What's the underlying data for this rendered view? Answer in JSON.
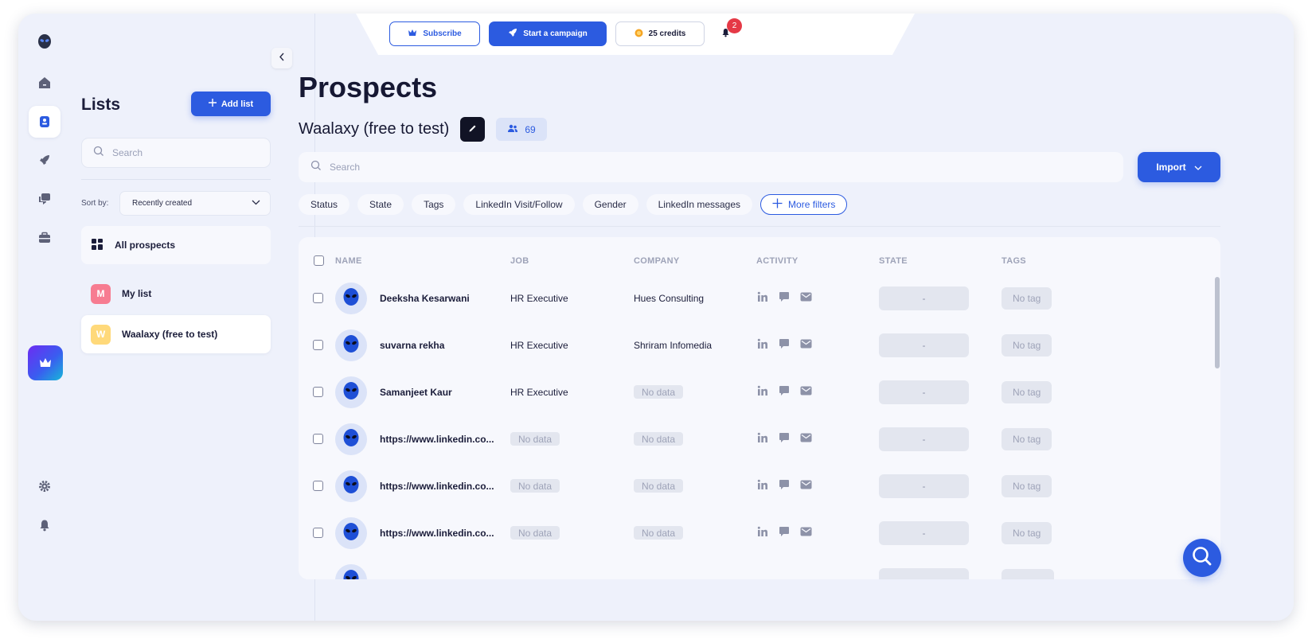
{
  "colors": {
    "brand": "#2c5be0",
    "badge_red": "#e53946",
    "list_my": "#f77c91",
    "list_waalaxy": "#ffd97a"
  },
  "rail": {
    "items": [
      {
        "name": "logo-icon"
      },
      {
        "name": "home-icon"
      },
      {
        "name": "prospects-icon"
      },
      {
        "name": "campaigns-rocket-icon"
      },
      {
        "name": "inbox-chat-icon"
      },
      {
        "name": "toolbox-icon"
      },
      {
        "name": "premium-crown-icon"
      },
      {
        "name": "settings-gear-icon"
      },
      {
        "name": "notifications-bell-icon"
      }
    ]
  },
  "topbar": {
    "subscribe_label": "Subscribe",
    "campaign_label": "Start a campaign",
    "credits_label": "25 credits",
    "notification_count": "2"
  },
  "lists_panel": {
    "title": "Lists",
    "add_label": "Add list",
    "search_placeholder": "Search",
    "sort_label": "Sort by:",
    "sort_value": "Recently created",
    "all_label": "All prospects",
    "items": [
      {
        "initial": "M",
        "label": "My list"
      },
      {
        "initial": "W",
        "label": "Waalaxy (free to test)"
      }
    ]
  },
  "main": {
    "title": "Prospects",
    "list_name": "Waalaxy (free to test)",
    "prospect_count": "69",
    "search_placeholder": "Search",
    "import_label": "Import",
    "filters": [
      "Status",
      "State",
      "Tags",
      "LinkedIn Visit/Follow",
      "Gender",
      "LinkedIn messages"
    ],
    "more_filters_label": "More filters"
  },
  "table": {
    "columns": [
      "NAME",
      "JOB",
      "COMPANY",
      "ACTIVITY",
      "STATE",
      "TAGS"
    ],
    "rows": [
      {
        "name": "Deeksha Kesarwani",
        "job": "HR Executive",
        "company": "Hues Consulting",
        "state": "-",
        "tags": "No tag"
      },
      {
        "name": "suvarna rekha",
        "job": "HR Executive",
        "company": "Shriram Infomedia",
        "state": "-",
        "tags": "No tag"
      },
      {
        "name": "Samanjeet Kaur",
        "job": "HR Executive",
        "company": "No data",
        "state": "-",
        "tags": "No tag"
      },
      {
        "name": "https://www.linkedin.co...",
        "job": "No data",
        "company": "No data",
        "state": "-",
        "tags": "No tag"
      },
      {
        "name": "https://www.linkedin.co...",
        "job": "No data",
        "company": "No data",
        "state": "-",
        "tags": "No tag"
      },
      {
        "name": "https://www.linkedin.co...",
        "job": "No data",
        "company": "No data",
        "state": "-",
        "tags": "No tag"
      }
    ]
  }
}
